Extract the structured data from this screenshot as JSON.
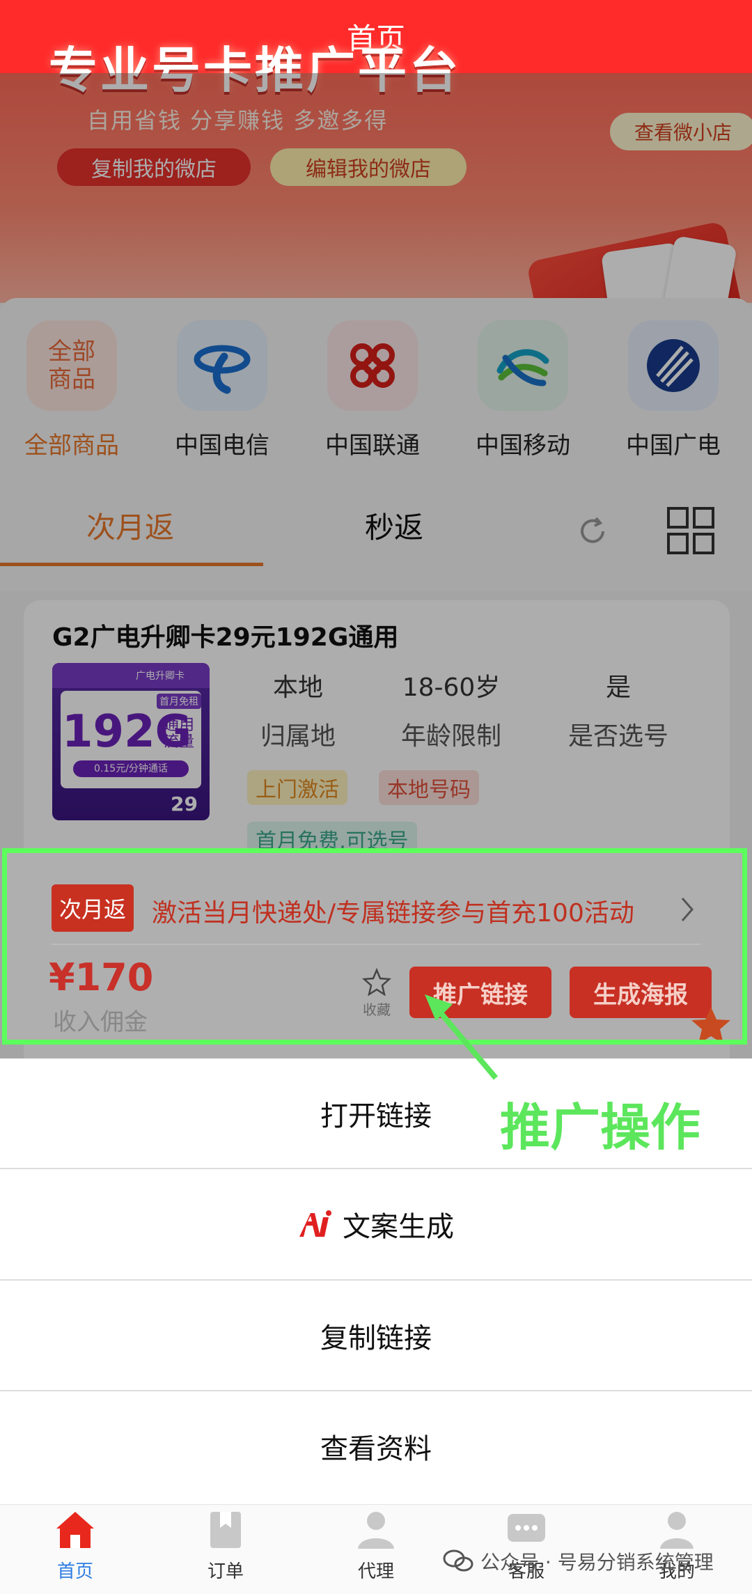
{
  "header": {
    "title": "首页"
  },
  "banner": {
    "title": "专业号卡推广平台",
    "subtitle": "自用省钱   分享赚钱   多邀多得",
    "copy_shop": "复制我的微店",
    "edit_shop": "编辑我的微店",
    "view_shop": "查看微小店"
  },
  "categories": {
    "all_icon_text": "全部商品",
    "items": [
      {
        "label": "全部商品"
      },
      {
        "label": "中国电信"
      },
      {
        "label": "中国联通"
      },
      {
        "label": "中国移动"
      },
      {
        "label": "中国广电"
      }
    ]
  },
  "tabs": {
    "items": [
      {
        "label": "次月返"
      },
      {
        "label": "秒返"
      }
    ]
  },
  "product": {
    "title": "G2广电升卿卡29元192G通用",
    "image": {
      "top_label": "广电升卿卡",
      "data": "192G",
      "data_sub": "通用流量",
      "call": "0.15元/分钟通话",
      "first_month": "首月免租",
      "price": "29"
    },
    "attrs": [
      {
        "value": "本地",
        "label": "归属地"
      },
      {
        "value": "18-60岁",
        "label": "年龄限制"
      },
      {
        "value": "是",
        "label": "是否选号"
      }
    ],
    "tags": [
      "上门激活",
      "本地号码",
      "首月免费,可选号"
    ],
    "badge": "次月返",
    "promo": "激活当月快递处/专属链接参与首充100活动",
    "price": "¥170",
    "income_label": "收入佣金",
    "fav_label": "收藏",
    "promote_link": "推广链接",
    "make_poster": "生成海报"
  },
  "annotation": "推广操作",
  "sheet": {
    "open_link": "打开链接",
    "ai_copy": "文案生成",
    "copy_link": "复制链接",
    "view_info": "查看资料"
  },
  "nav": {
    "items": [
      {
        "label": "首页",
        "icon": "home-icon"
      },
      {
        "label": "订单",
        "icon": "order-icon"
      },
      {
        "label": "代理",
        "icon": "agent-icon"
      },
      {
        "label": "客服",
        "icon": "chat-icon"
      },
      {
        "label": "我的",
        "icon": "user-icon"
      }
    ]
  },
  "watermark": "公众号 · 号易分销系统管理",
  "colors": {
    "brand": "#ff2a2a",
    "accent": "#e8782c",
    "highlight": "#5cff5c",
    "nav_active": "#2f7de1"
  }
}
